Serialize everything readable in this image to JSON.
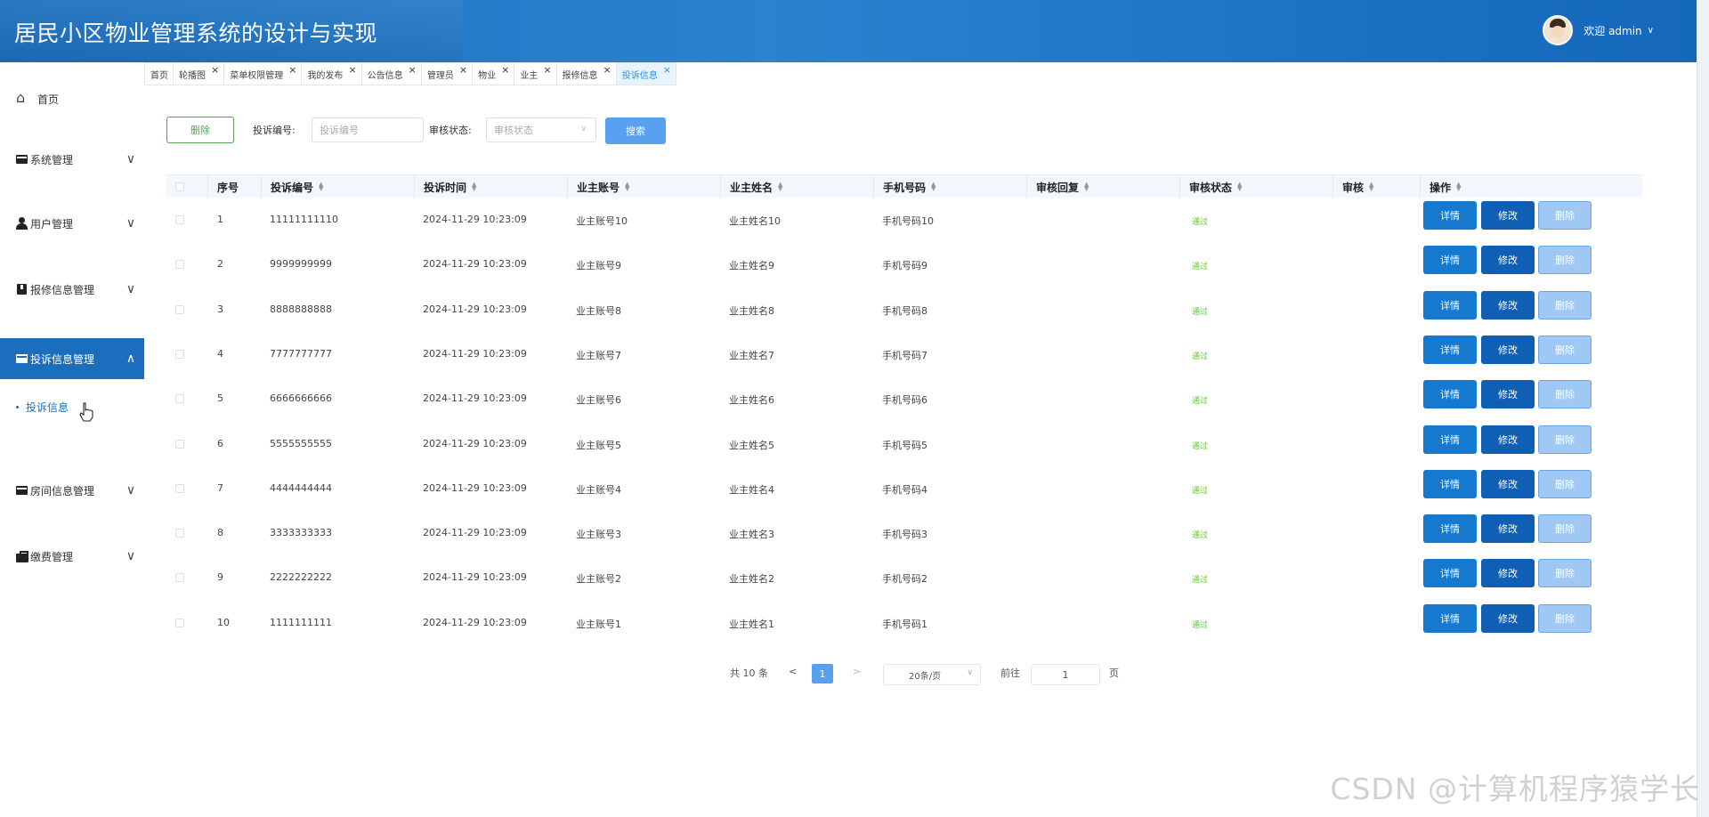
{
  "header": {
    "title": "居民小区物业管理系统的设计与实现",
    "welcome": "欢迎 admin",
    "caret": "∨"
  },
  "sidebar": {
    "items": [
      {
        "label": "首页",
        "icon": "home-icon",
        "arrow": ""
      },
      {
        "label": "系统管理",
        "icon": "card-icon",
        "arrow": "∨"
      },
      {
        "label": "用户管理",
        "icon": "user-icon",
        "arrow": "∨"
      },
      {
        "label": "报修信息管理",
        "icon": "book-icon",
        "arrow": "∨"
      },
      {
        "label": "投诉信息管理",
        "icon": "card-icon",
        "arrow": "∧"
      },
      {
        "label": "房间信息管理",
        "icon": "card-icon",
        "arrow": "∨"
      },
      {
        "label": "缴费管理",
        "icon": "bag-icon",
        "arrow": "∨"
      }
    ],
    "submenu": {
      "label": "投诉信息"
    }
  },
  "tabs": [
    {
      "label": "首页",
      "close": ""
    },
    {
      "label": "轮播图",
      "close": "×"
    },
    {
      "label": "菜单权限管理",
      "close": "×"
    },
    {
      "label": "我的发布",
      "close": "×"
    },
    {
      "label": "公告信息",
      "close": "×"
    },
    {
      "label": "管理员",
      "close": "×"
    },
    {
      "label": "物业",
      "close": "×"
    },
    {
      "label": "业主",
      "close": "×"
    },
    {
      "label": "报修信息",
      "close": "×"
    },
    {
      "label": "投诉信息",
      "close": "×"
    }
  ],
  "toolbar": {
    "delete_label": "删除",
    "complaint_no_label": "投诉编号:",
    "complaint_no_placeholder": "投诉编号",
    "status_label": "审核状态:",
    "status_placeholder": "审核状态",
    "search_label": "搜索"
  },
  "table": {
    "columns": [
      "序号",
      "投诉编号",
      "投诉时间",
      "业主账号",
      "业主姓名",
      "手机号码",
      "审核回复",
      "审核状态",
      "审核",
      "操作"
    ],
    "rows": [
      {
        "idx": "1",
        "no": "11111111110",
        "time": "2024-11-29 10:23:09",
        "account": "业主账号10",
        "name": "业主姓名10",
        "phone": "手机号码10",
        "reply": "",
        "status": "通过"
      },
      {
        "idx": "2",
        "no": "9999999999",
        "time": "2024-11-29 10:23:09",
        "account": "业主账号9",
        "name": "业主姓名9",
        "phone": "手机号码9",
        "reply": "",
        "status": "通过"
      },
      {
        "idx": "3",
        "no": "8888888888",
        "time": "2024-11-29 10:23:09",
        "account": "业主账号8",
        "name": "业主姓名8",
        "phone": "手机号码8",
        "reply": "",
        "status": "通过"
      },
      {
        "idx": "4",
        "no": "7777777777",
        "time": "2024-11-29 10:23:09",
        "account": "业主账号7",
        "name": "业主姓名7",
        "phone": "手机号码7",
        "reply": "",
        "status": "通过"
      },
      {
        "idx": "5",
        "no": "6666666666",
        "time": "2024-11-29 10:23:09",
        "account": "业主账号6",
        "name": "业主姓名6",
        "phone": "手机号码6",
        "reply": "",
        "status": "通过"
      },
      {
        "idx": "6",
        "no": "5555555555",
        "time": "2024-11-29 10:23:09",
        "account": "业主账号5",
        "name": "业主姓名5",
        "phone": "手机号码5",
        "reply": "",
        "status": "通过"
      },
      {
        "idx": "7",
        "no": "4444444444",
        "time": "2024-11-29 10:23:09",
        "account": "业主账号4",
        "name": "业主姓名4",
        "phone": "手机号码4",
        "reply": "",
        "status": "通过"
      },
      {
        "idx": "8",
        "no": "3333333333",
        "time": "2024-11-29 10:23:09",
        "account": "业主账号3",
        "name": "业主姓名3",
        "phone": "手机号码3",
        "reply": "",
        "status": "通过"
      },
      {
        "idx": "9",
        "no": "2222222222",
        "time": "2024-11-29 10:23:09",
        "account": "业主账号2",
        "name": "业主姓名2",
        "phone": "手机号码2",
        "reply": "",
        "status": "通过"
      },
      {
        "idx": "10",
        "no": "1111111111",
        "time": "2024-11-29 10:23:09",
        "account": "业主账号1",
        "name": "业主姓名1",
        "phone": "手机号码1",
        "reply": "",
        "status": "通过"
      }
    ],
    "actions": {
      "detail": "详情",
      "edit": "修改",
      "delete": "删除"
    }
  },
  "pagination": {
    "total": "共 10 条",
    "prev": "<",
    "current": "1",
    "next": ">",
    "page_size": "20条/页",
    "goto_label": "前往",
    "goto_value": "1",
    "page_unit": "页"
  },
  "watermark": "CSDN @计算机程序猿学长",
  "colors": {
    "header": "#1d6fbf",
    "active_menu": "#1b6ebd",
    "primary": "#5aa0f0",
    "status_ok": "#67c23a"
  }
}
